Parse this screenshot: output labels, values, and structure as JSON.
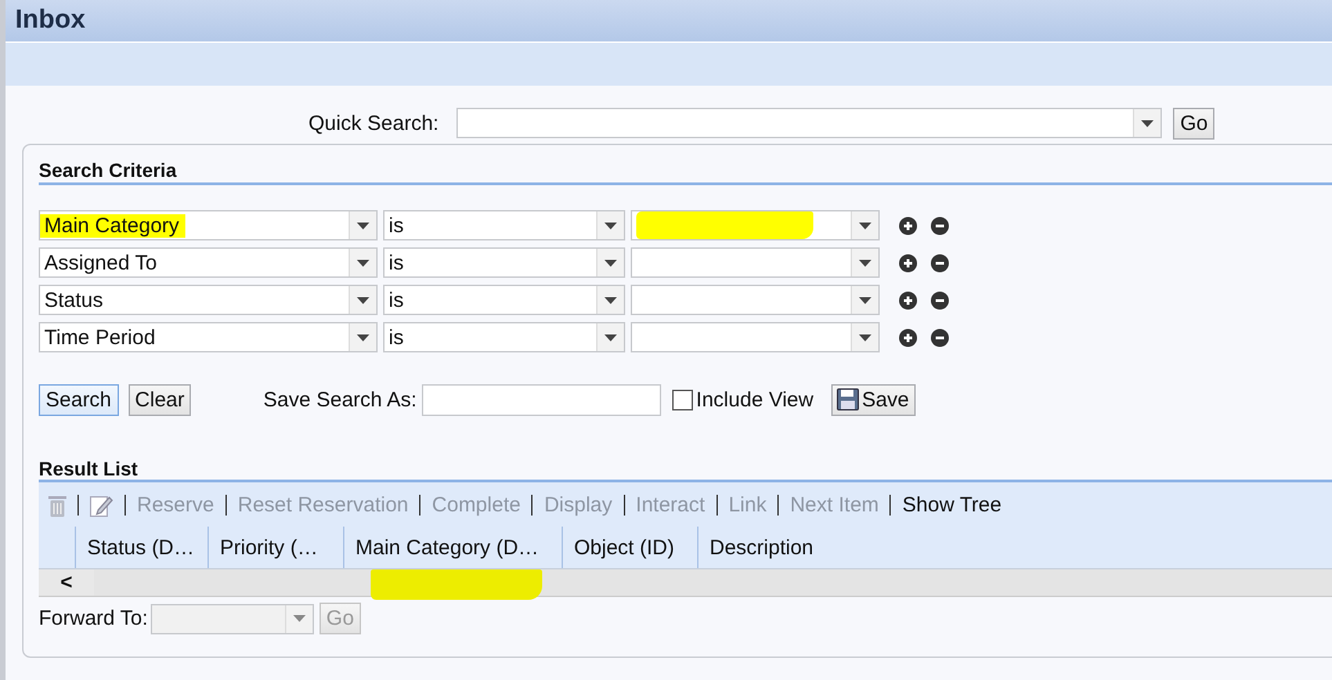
{
  "window": {
    "title": "Inbox"
  },
  "quick_search": {
    "label": "Quick Search:",
    "button": "Go"
  },
  "search_criteria": {
    "title": "Search Criteria",
    "rows": [
      {
        "field": "Main Category",
        "operator": "is",
        "field_highlighted": true,
        "value_highlighted": true
      },
      {
        "field": "Assigned To",
        "operator": "is",
        "field_highlighted": false,
        "value_highlighted": false
      },
      {
        "field": "Status",
        "operator": "is",
        "field_highlighted": false,
        "value_highlighted": false
      },
      {
        "field": "Time Period",
        "operator": "is",
        "field_highlighted": false,
        "value_highlighted": false
      }
    ],
    "buttons": [
      {
        "label": "Search",
        "selected": true
      },
      {
        "label": "Clear",
        "selected": false
      }
    ],
    "save_label": "Save Search As:",
    "include_view": {
      "label": "Include View",
      "checked": false
    },
    "save_button": "Save"
  },
  "result_list": {
    "title": "Result List",
    "toolbar": [
      {
        "kind": "trash",
        "disabled": true
      },
      {
        "kind": "edit",
        "disabled": true
      },
      {
        "kind": "text",
        "label": "Reserve",
        "disabled": true
      },
      {
        "kind": "text",
        "label": "Reset Reservation",
        "disabled": true
      },
      {
        "kind": "text",
        "label": "Complete",
        "disabled": true
      },
      {
        "kind": "text",
        "label": "Display",
        "disabled": true
      },
      {
        "kind": "text",
        "label": "Interact",
        "disabled": true
      },
      {
        "kind": "text",
        "label": "Link",
        "disabled": true
      },
      {
        "kind": "text",
        "label": "Next Item",
        "disabled": true
      },
      {
        "kind": "text",
        "label": "Show Tree",
        "disabled": false
      }
    ],
    "columns": [
      {
        "label": "Status (D…"
      },
      {
        "label": "Priority (…"
      },
      {
        "label": "Main Category (D…"
      },
      {
        "label": "Object (ID)"
      },
      {
        "label": "Description"
      }
    ],
    "scroll_left": "<",
    "scrollbar_highlighted": true,
    "forward_label": "Forward To:",
    "forward_disabled": true,
    "forward_button": "Go"
  }
}
